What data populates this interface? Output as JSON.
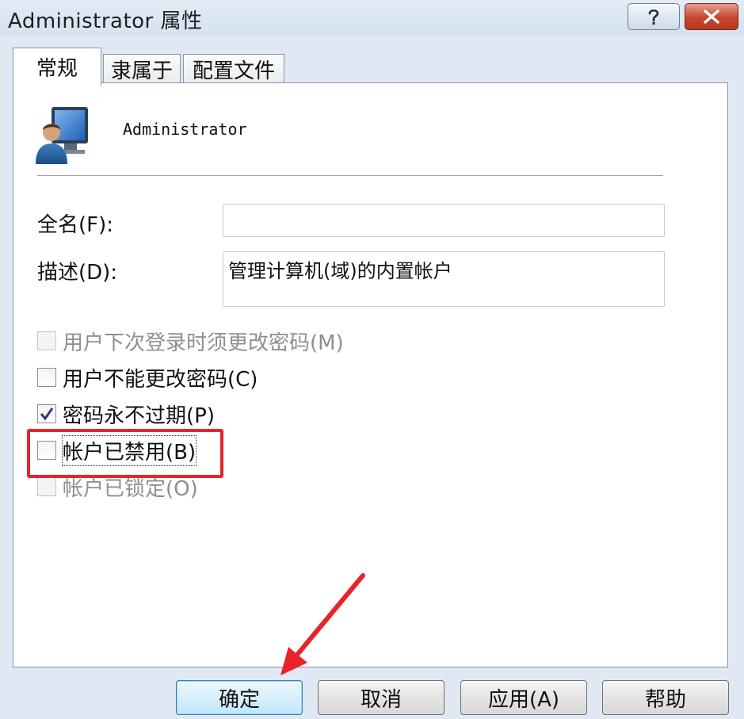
{
  "window": {
    "title": "Administrator 属性"
  },
  "tabs": [
    {
      "label": "常规",
      "active": true
    },
    {
      "label": "隶属于",
      "active": false
    },
    {
      "label": "配置文件",
      "active": false
    }
  ],
  "user": {
    "name": "Administrator",
    "icon": "user-account-icon"
  },
  "fields": {
    "full_name_label": "全名(F):",
    "full_name_value": "",
    "description_label": "描述(D):",
    "description_value": "管理计算机(域)的内置帐户"
  },
  "checkboxes": [
    {
      "label": "用户下次登录时须更改密码(M)",
      "checked": false,
      "enabled": false
    },
    {
      "label": "用户不能更改密码(C)",
      "checked": false,
      "enabled": true
    },
    {
      "label": "密码永不过期(P)",
      "checked": true,
      "enabled": true
    },
    {
      "label": "帐户已禁用(B)",
      "checked": false,
      "enabled": true
    },
    {
      "label": "帐户已锁定(O)",
      "checked": false,
      "enabled": false
    }
  ],
  "buttons": {
    "ok": "确定",
    "cancel": "取消",
    "apply": "应用(A)",
    "help": "帮助"
  },
  "annotation": {
    "highlight_color": "#e6242a",
    "arrow_color": "#e6242a"
  }
}
